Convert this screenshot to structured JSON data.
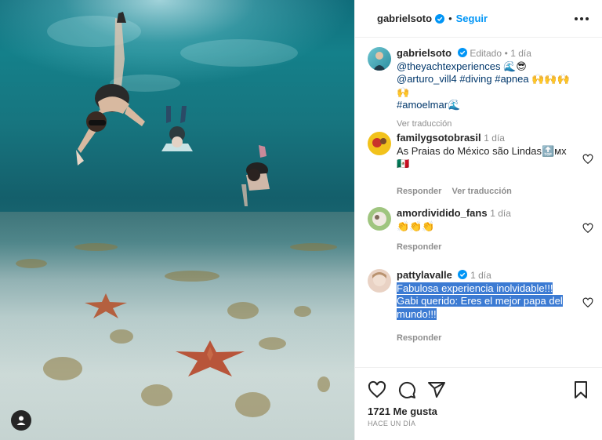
{
  "post_author": {
    "username": "gabrielsoto",
    "follow_label": "Seguir",
    "separator": "•"
  },
  "caption": {
    "username": "gabrielsoto",
    "edited": "Editado",
    "time": "1 día",
    "line1_mention": "@theyachtexperiences",
    "line1_emoji": "🌊😎",
    "line2_mention": "@arturo_vill4",
    "line2_tags": "#diving #apnea",
    "line2_emoji": "🙌🙌🙌🙌",
    "line3_tag": "#amoelmar",
    "line3_emoji": "🌊",
    "translate_label": "Ver traducción"
  },
  "comments": [
    {
      "username": "familygsotobrasil",
      "time": "1 día",
      "text": "As Praias do México são Lindas🔝мх 🇲🇽",
      "reply_label": "Responder",
      "translate_label": "Ver traducción"
    },
    {
      "username": "amordividido_fans",
      "time": "1 día",
      "text": "👏👏👏",
      "reply_label": "Responder"
    },
    {
      "username": "pattylavalle",
      "time": "1 día",
      "text_line1": "Fabulosa experiencia inolvidable!!!",
      "text_line2": "Gabi querido: Eres el mejor papa del",
      "text_line3": "mundo!!!",
      "reply_label": "Responder"
    }
  ],
  "footer": {
    "likes": "1721 Me gusta",
    "ago": "HACE UN DÍA"
  },
  "icons": {
    "verified": "verified-badge-icon",
    "more": "more-options-icon",
    "like": "heart-icon",
    "comment": "comment-icon",
    "share": "share-icon",
    "save": "bookmark-icon",
    "user_tag": "user-tag-icon"
  },
  "colors": {
    "accent": "#0095f6",
    "selection": "#3c7bd3",
    "secondary_text": "#8e8e8e"
  }
}
